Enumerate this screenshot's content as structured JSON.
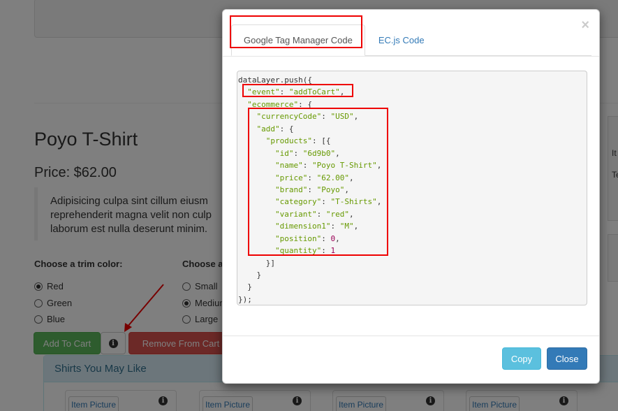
{
  "product": {
    "title": "Poyo T-Shirt",
    "price": "Price: $62.00",
    "description_lines": [
      "Adipisicing culpa sint cillum eiusm",
      "reprehenderit magna velit non culp",
      "laborum est nulla deserunt minim."
    ]
  },
  "options": {
    "trim_label": "Choose a trim color:",
    "size_label": "Choose a",
    "trim_colors": [
      {
        "label": "Red",
        "checked": true
      },
      {
        "label": "Green",
        "checked": false
      },
      {
        "label": "Blue",
        "checked": false
      }
    ],
    "sizes": [
      {
        "label": "Small",
        "checked": false
      },
      {
        "label": "Medium",
        "checked": true
      },
      {
        "label": "Large",
        "checked": false
      }
    ]
  },
  "buttons": {
    "add_to_cart": "Add To Cart",
    "info_glyph": "i",
    "remove_from_cart": "Remove From Cart"
  },
  "related": {
    "heading": "Shirts You May Like",
    "item_label": "Item Picture",
    "info_glyph": "i"
  },
  "right_panel": {
    "text1": "It",
    "text2": "Te"
  },
  "modal": {
    "close_symbol": "×",
    "tabs": [
      {
        "label": "Google Tag Manager Code",
        "active": true
      },
      {
        "label": "EC.js Code",
        "active": false
      }
    ],
    "code_lines": [
      "dataLayer.push({",
      "  \"event\": \"addToCart\",",
      "  \"ecommerce\": {",
      "    \"currencyCode\": \"USD\",",
      "    \"add\": {",
      "      \"products\": [{",
      "        \"id\": \"6d9b0\",",
      "        \"name\": \"Poyo T-Shirt\",",
      "        \"price\": \"62.00\",",
      "        \"brand\": \"Poyo\",",
      "        \"category\": \"T-Shirts\",",
      "        \"variant\": \"red\",",
      "        \"dimension1\": \"M\",",
      "        \"position\": 0,",
      "        \"quantity\": 1",
      "      }]",
      "    }",
      "  }",
      "});"
    ],
    "copy_label": "Copy",
    "close_label": "Close"
  },
  "colors": {
    "highlight": "#e00000",
    "success": "#5cb85c",
    "danger": "#d9534f",
    "info": "#5bc0de",
    "primary": "#337ab7"
  }
}
